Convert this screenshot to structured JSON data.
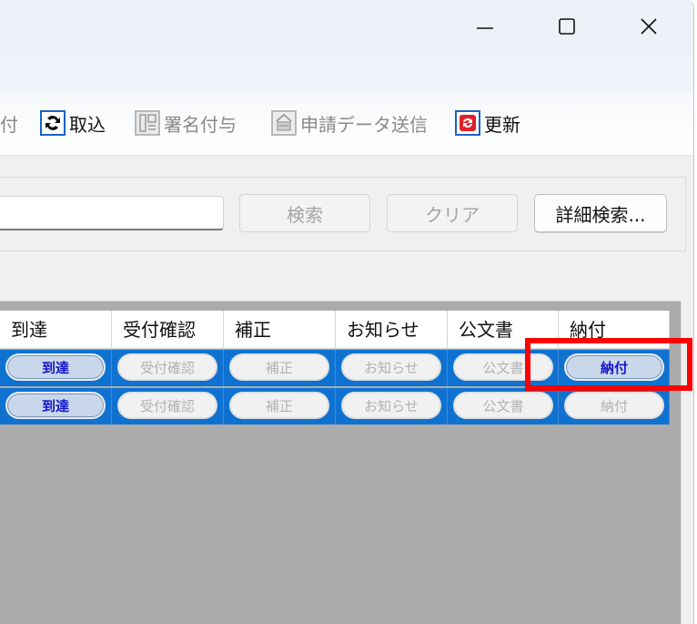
{
  "window": {
    "minimize_icon": "minimize-icon",
    "maximize_icon": "maximize-icon",
    "close_icon": "close-icon"
  },
  "toolbar": {
    "items": [
      {
        "label": "付",
        "icon": "attach-icon",
        "enabled": false
      },
      {
        "label": "取込",
        "icon": "import-icon",
        "enabled": true
      },
      {
        "label": "署名付与",
        "icon": "signature-icon",
        "enabled": false
      },
      {
        "label": "申請データ送信",
        "icon": "send-data-icon",
        "enabled": false
      },
      {
        "label": "更新",
        "icon": "refresh-icon",
        "enabled": true
      }
    ]
  },
  "search": {
    "input_value": "",
    "search_label": "検索",
    "clear_label": "クリア",
    "advanced_label": "詳細検索..."
  },
  "grid": {
    "columns": [
      "到達",
      "受付確認",
      "補正",
      "お知らせ",
      "公文書",
      "納付"
    ],
    "rows": [
      [
        {
          "label": "到達",
          "enabled": true
        },
        {
          "label": "受付確認",
          "enabled": false
        },
        {
          "label": "補正",
          "enabled": false
        },
        {
          "label": "お知らせ",
          "enabled": false
        },
        {
          "label": "公文書",
          "enabled": false
        },
        {
          "label": "納付",
          "enabled": true
        }
      ],
      [
        {
          "label": "到達",
          "enabled": true
        },
        {
          "label": "受付確認",
          "enabled": false
        },
        {
          "label": "補正",
          "enabled": false
        },
        {
          "label": "お知らせ",
          "enabled": false
        },
        {
          "label": "公文書",
          "enabled": false
        },
        {
          "label": "納付",
          "enabled": false
        }
      ]
    ]
  },
  "colors": {
    "row_selected": "#0f72d1",
    "highlight_box": "#ff0000"
  }
}
